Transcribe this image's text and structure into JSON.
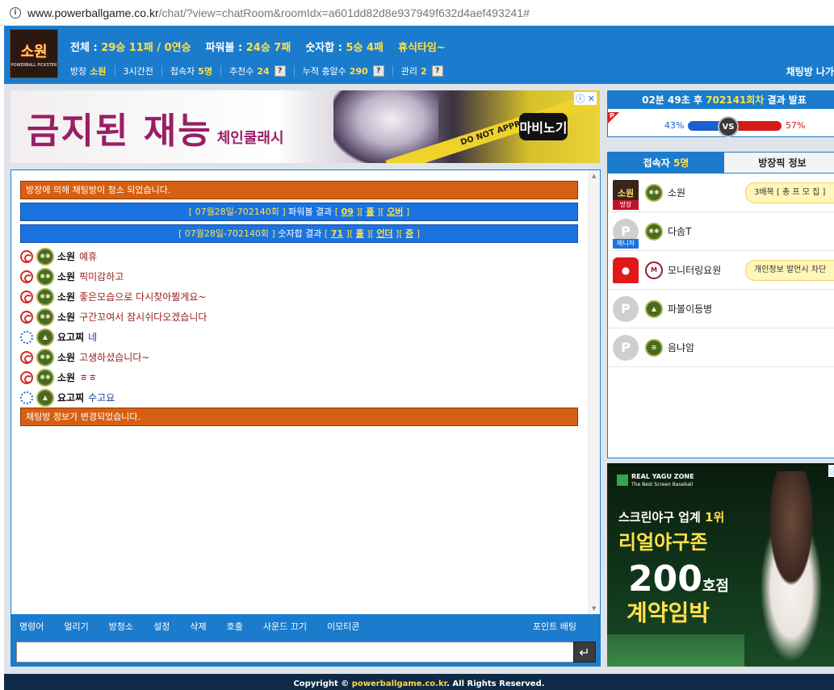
{
  "browser": {
    "url_domain": "www.powerballgame.co.kr",
    "url_rest": "/chat/?view=chatRoom&roomIdx=a601dd82d8e937949f632d4aef493241#"
  },
  "header": {
    "logo_text": "소원",
    "logo_sub": "POWERBALL PICKSTER",
    "stats": {
      "total_label": "전체 :",
      "total_value": "29승 11패 / 0연승",
      "power_label": "파워볼 :",
      "power_value": "24승 7패",
      "sum_label": "숫자합 :",
      "sum_value": "5승 4패",
      "status": "휴식타임~"
    },
    "info": {
      "owner_label": "방장",
      "owner_value": "소원",
      "time": "3시간전",
      "users_label": "접속자",
      "users_value": "5명",
      "recommend_label": "추천수",
      "recommend_value": "24",
      "gift_label": "누적 충알수",
      "gift_value": "290",
      "manage_label": "관리",
      "manage_value": "2",
      "q": "?"
    },
    "exit_label": "채팅방 나가"
  },
  "top_ad": {
    "title": "금지된 재능",
    "sub": "체인쿨래시",
    "tape": "DO NOT APPROACH",
    "logo": "마비노기",
    "adchoice": "ⓘ ✕"
  },
  "chat": {
    "system1": "방장에 의해 채팅방이 청소 되었습니다.",
    "power": {
      "prefix": "[ 07월28일-702140회 ]",
      "mid": " 파워볼 결과 ",
      "v1": "09",
      "v2": "홀",
      "v3": "오버"
    },
    "sum": {
      "prefix": "[ 07월28일-702140회 ]",
      "mid": " 숫자합 결과 ",
      "v1": "71",
      "v2": "홀",
      "v3": "언더",
      "v4": "중"
    },
    "messages": [
      {
        "nick": "소원",
        "text": "예휴"
      },
      {
        "nick": "소원",
        "text": "픽미감하고"
      },
      {
        "nick": "소원",
        "text": "좋은모습으로 다시찾아뵐게요~"
      },
      {
        "nick": "소원",
        "text": "구간꼬여서 잠시쉬다오겠습니다"
      },
      {
        "nick": "요고찌",
        "text": "네"
      },
      {
        "nick": "소원",
        "text": "고생하셨습니다~"
      },
      {
        "nick": "소원",
        "text": "ㅎㅎ"
      },
      {
        "nick": "요고찌",
        "text": "수고요"
      }
    ],
    "system2": "채팅방 정보가 변경되었습니다."
  },
  "menu": {
    "items": [
      "명령어",
      "얼리기",
      "방청소",
      "설정",
      "삭제",
      "호출",
      "사운드 끄기",
      "이모티콘"
    ],
    "right": "포인트 배팅"
  },
  "input": {
    "placeholder": "",
    "send_icon": "↵"
  },
  "footer": {
    "prefix": "Copyright © ",
    "link": "powerballgame.co.kr",
    "suffix": ". All Rights Reserved."
  },
  "result": {
    "timer": "02분 49초 후",
    "round": "702141회차",
    "suffix": "결과 발표",
    "badge": "P",
    "left_pct": "43%",
    "right_pct": "57%",
    "left_share": 43,
    "vs": "VS"
  },
  "users_panel": {
    "tab_users_label": "접속자",
    "tab_users_count": "5명",
    "tab_info": "방장픽 정보",
    "users": [
      {
        "name": "소원",
        "role": "방장",
        "bubble": "3배목 [ 총 프 모 집 ]"
      },
      {
        "name": "다솜T",
        "role": "매니저",
        "bubble": ""
      },
      {
        "name": "모니터링요원",
        "role": "",
        "bubble": "개인정보 발언시 차단"
      },
      {
        "name": "파볼이등병",
        "role": "",
        "bubble": ""
      },
      {
        "name": "음냐암",
        "role": "",
        "bubble": ""
      }
    ]
  },
  "side_ad": {
    "brand": "REAL YAGU ZONE",
    "brand_sub": "The Best Screen Baseball",
    "line1_a": "스크린야구 업계 ",
    "line1_b": "1위",
    "line2": "리얼야구존",
    "line3": "200",
    "line3_s": "호점",
    "line4": "계약임박",
    "adchoice": "ⓘ"
  },
  "colors": {
    "accent": "#1b7ccd",
    "system_orange": "#d75f11",
    "system_blue": "#1b73e0",
    "highlight": "#ffe14a"
  }
}
